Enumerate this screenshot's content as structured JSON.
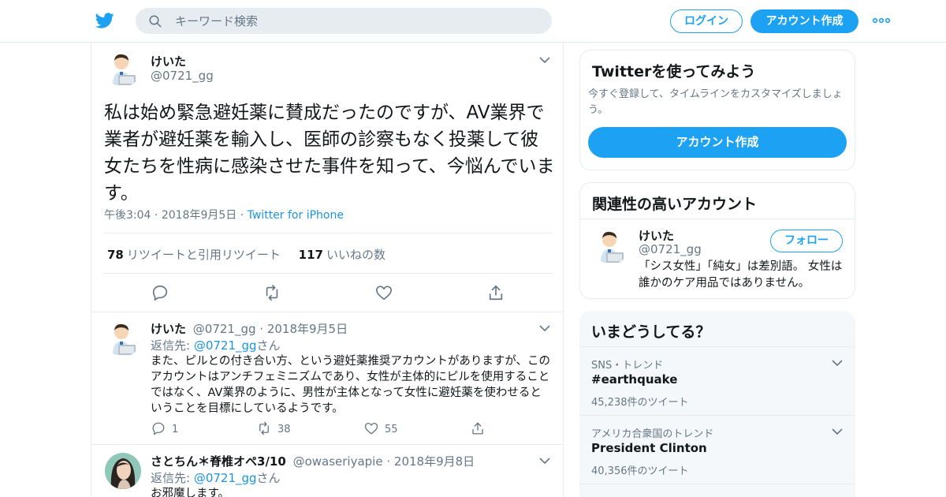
{
  "header": {
    "search_placeholder": "キーワード検索",
    "login_label": "ログイン",
    "signup_label": "アカウント作成"
  },
  "main_tweet": {
    "name": "けいた",
    "handle": "@0721_gg",
    "text": "私は始め緊急避妊薬に賛成だったのですが、AV業界で業者が避妊薬を輸入し、医師の診察もなく投薬して彼女たちを性病に感染させた事件を知って、今悩んでいます。",
    "time": "午後3:04",
    "date": "2018年9月5日",
    "source": "Twitter for iPhone",
    "retweet_count": "78",
    "retweet_label": "リツイートと引用リツイート",
    "like_count": "117",
    "like_label": "いいねの数"
  },
  "replies": [
    {
      "name": "けいた",
      "handle": "@0721_gg",
      "date": "2018年9月5日",
      "reply_to_prefix": "返信先: ",
      "reply_to_handle": "@0721_gg",
      "reply_to_suffix": "さん",
      "text": "また、ピルとの付き合い方、という避妊薬推奨アカウントがありますが、このアカウントはアンチフェミニズムであり、女性が主体的にピルを使用することではなく、AV業界のように、男性が主体となって女性に避妊薬を使わせるということを目標にしているようです。",
      "reply_count": "1",
      "retweet_count": "38",
      "like_count": "55"
    },
    {
      "name": "さとちん＊脊椎オペ3/10",
      "handle": "@owaseriyapie",
      "date": "2018年9月8日",
      "reply_to_prefix": "返信先: ",
      "reply_to_handle": "@0721_gg",
      "reply_to_suffix": "さん",
      "text": "お邪魔します。"
    }
  ],
  "sidebar": {
    "signup_card": {
      "title": "Twitterを使ってみよう",
      "description": "今すぐ登録して、タイムラインをカスタマイズしましょう。",
      "button_label": "アカウント作成"
    },
    "related_card": {
      "title": "関連性の高いアカウント",
      "name": "けいた",
      "handle": "@0721_gg",
      "follow_label": "フォロー",
      "bio": "「シス女性」「純女」は差別語。 女性は誰かのケア用品ではありません。"
    },
    "trends_card": {
      "title": "いまどうしてる？",
      "trends": [
        {
          "context": "SNS・トレンド",
          "name": "#earthquake",
          "count": "45,238件のツイート"
        },
        {
          "context": "アメリカ合衆国のトレンド",
          "name": "President Clinton",
          "count": "40,356件のツイート"
        }
      ]
    }
  },
  "colors": {
    "accent": "#1da1f2",
    "link": "#1b95e0",
    "secondary_text": "#657786"
  }
}
